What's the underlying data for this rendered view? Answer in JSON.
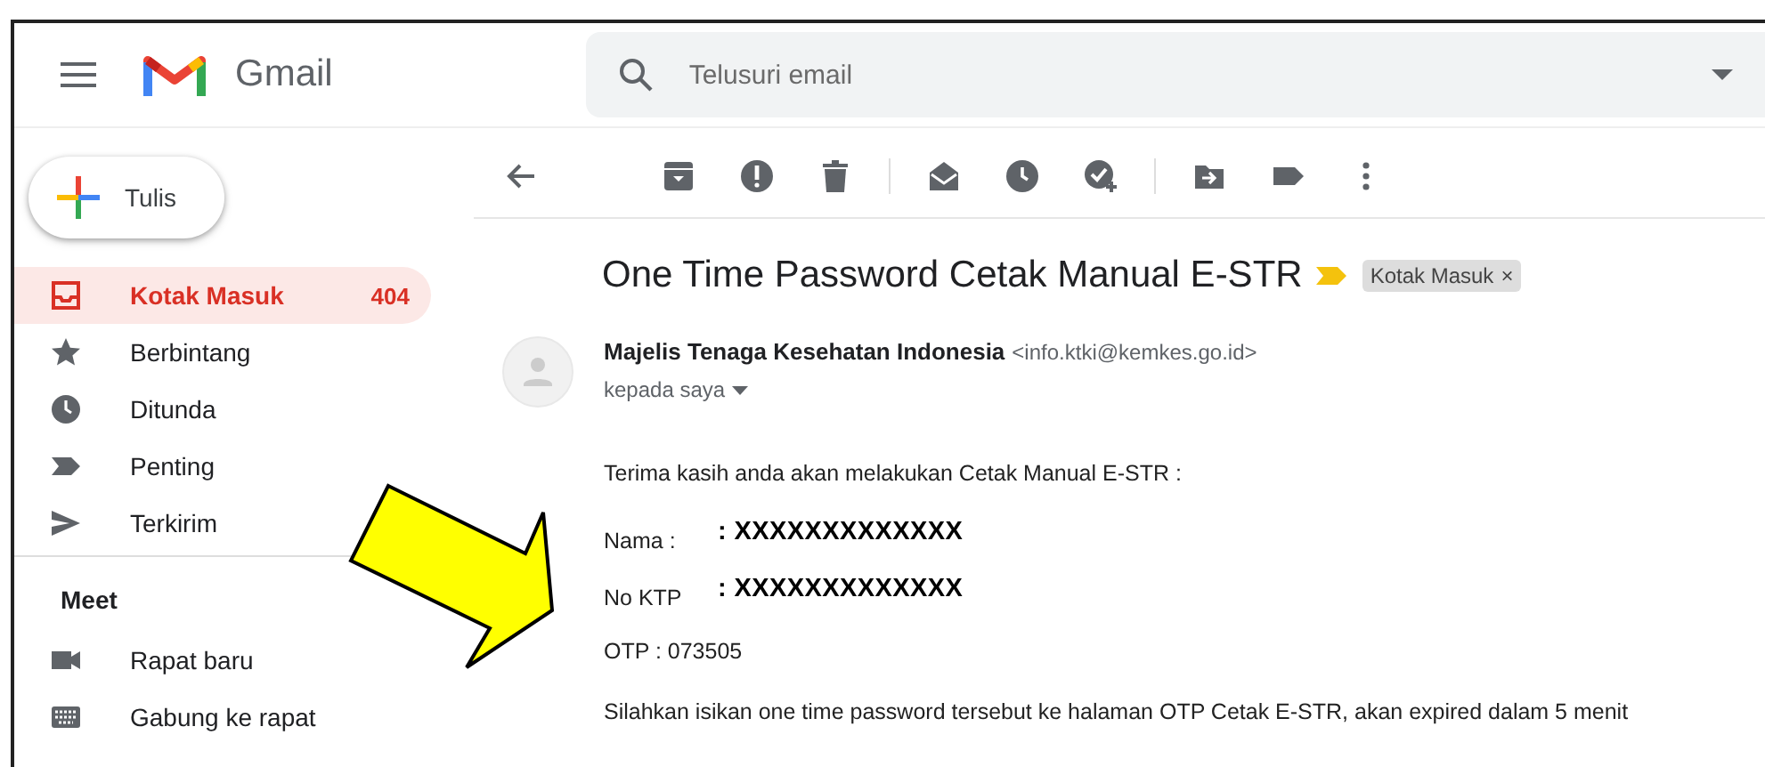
{
  "header": {
    "app_name": "Gmail",
    "search": {
      "placeholder": "Telusuri email"
    }
  },
  "compose": {
    "label": "Tulis"
  },
  "sidebar": {
    "items": [
      {
        "label": "Kotak Masuk",
        "count": "404",
        "selected": true
      },
      {
        "label": "Berbintang",
        "selected": false
      },
      {
        "label": "Ditunda",
        "selected": false
      },
      {
        "label": "Penting",
        "selected": false
      },
      {
        "label": "Terkirim",
        "selected": false
      }
    ]
  },
  "meet": {
    "title": "Meet",
    "items": [
      {
        "label": "Rapat baru"
      },
      {
        "label": "Gabung ke rapat"
      }
    ]
  },
  "message": {
    "subject": "One Time Password Cetak Manual E-STR",
    "labels": [
      {
        "text": "Kotak Masuk",
        "remove": "×"
      }
    ],
    "sender": {
      "name": "Majelis Tenaga Kesehatan Indonesia",
      "email": "<info.ktki@kemkes.go.id>",
      "recipient": "kepada saya"
    },
    "body": {
      "intro": "Terima kasih anda akan melakukan Cetak Manual E-STR :",
      "fields": [
        {
          "label": "Nama :",
          "value": ": XXXXXXXXXXXXX"
        },
        {
          "label": "No KTP",
          "value": ": XXXXXXXXXXXXX"
        }
      ],
      "otp": "OTP : 073505",
      "closing": "Silahkan isikan one time password tersebut ke halaman OTP Cetak E-STR, akan expired dalam 5 menit"
    }
  }
}
